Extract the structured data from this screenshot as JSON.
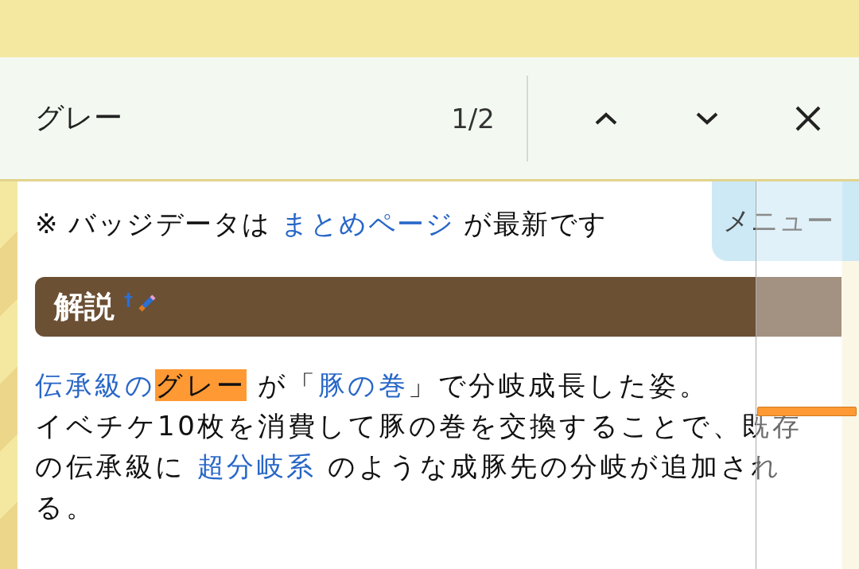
{
  "find_bar": {
    "query": "グレー",
    "count": "1/2"
  },
  "notice": [
    {
      "kind": "text",
      "text": "※ バッジデータは "
    },
    {
      "kind": "link",
      "text": "まとめページ"
    },
    {
      "kind": "text",
      "text": " が最新です"
    }
  ],
  "menu_button": {
    "label": "メニュー"
  },
  "section": {
    "title": "解説",
    "mark": "†"
  },
  "paragraph": [
    {
      "kind": "link",
      "text": "伝承級の"
    },
    {
      "kind": "match",
      "text": "グレー"
    },
    {
      "kind": "text",
      "text": " が「"
    },
    {
      "kind": "link",
      "text": "豚の巻"
    },
    {
      "kind": "text",
      "text": "」で分岐成長した姿。"
    },
    {
      "kind": "break"
    },
    {
      "kind": "text",
      "text": "イベチケ10枚を消費して豚の巻を交換することで、既存の伝承級に "
    },
    {
      "kind": "link",
      "text": "超分岐系"
    },
    {
      "kind": "text",
      "text": " のような成豚先の分岐が追加される。"
    }
  ]
}
